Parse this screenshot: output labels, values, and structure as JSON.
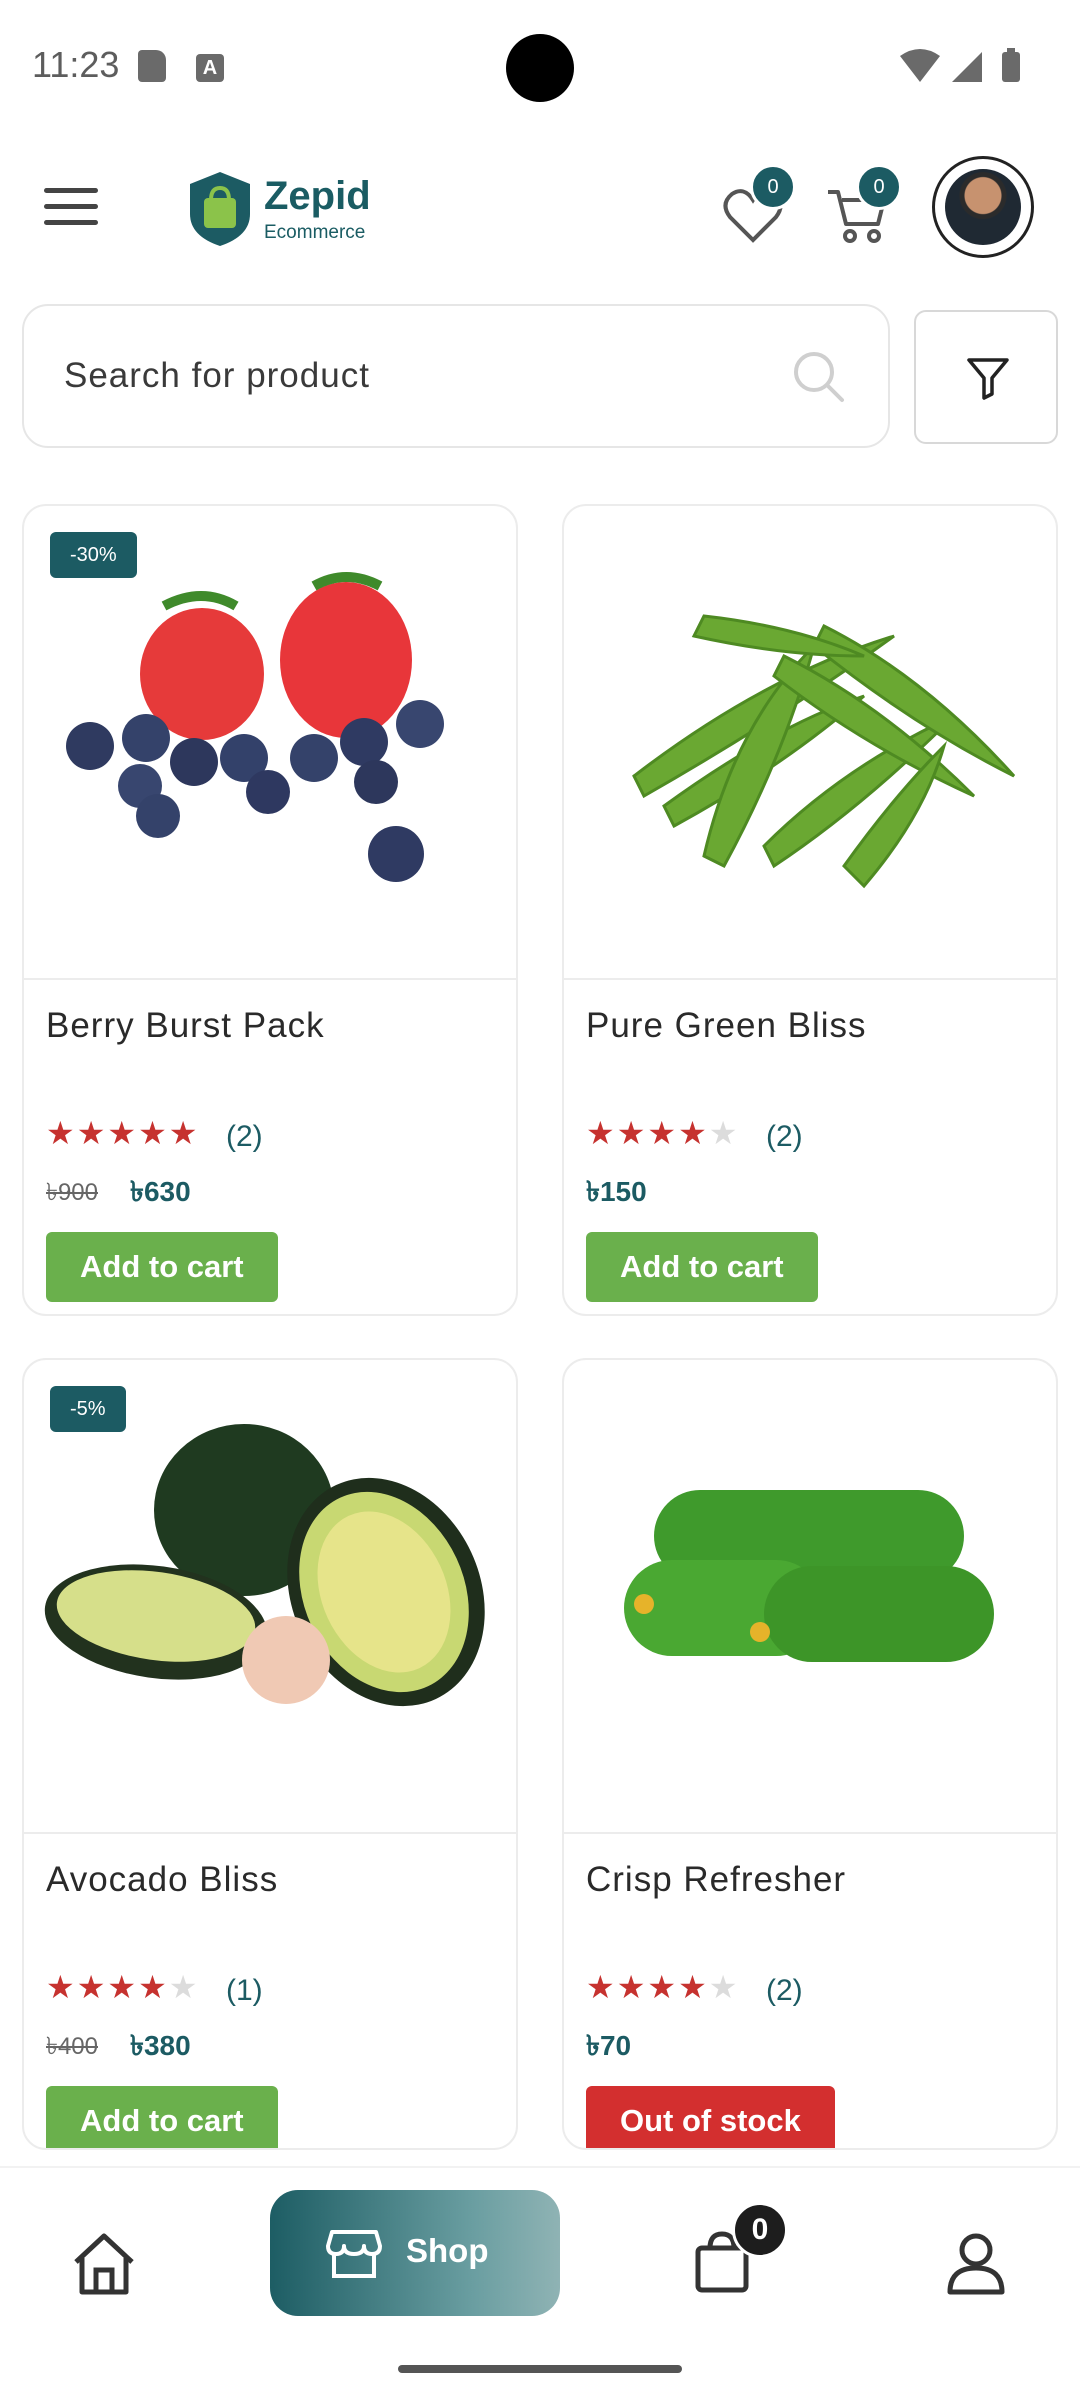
{
  "status": {
    "time": "11:23",
    "icons": [
      "sd-card-icon",
      "a-icon",
      "wifi-icon",
      "signal-icon",
      "battery-icon"
    ]
  },
  "header": {
    "logo_word": "Zepid",
    "logo_sub": "Ecommerce",
    "wishlist_count": "0",
    "cart_count": "0"
  },
  "search": {
    "placeholder": "Search for product"
  },
  "products": [
    {
      "name": "Berry Burst Pack",
      "discount": "-30%",
      "rating": 5,
      "reviews": "(2)",
      "old_price": "৳900",
      "price": "৳630",
      "action": "Add to cart"
    },
    {
      "name": "Pure Green Bliss",
      "discount": "",
      "rating": 4,
      "reviews": "(2)",
      "old_price": "",
      "price": "৳150",
      "action": "Add to cart"
    },
    {
      "name": "Avocado Bliss",
      "discount": "-5%",
      "rating": 4,
      "reviews": "(1)",
      "old_price": "৳400",
      "price": "৳380",
      "action": "Add to cart"
    },
    {
      "name": "Crisp Refresher",
      "discount": "",
      "rating": 4,
      "reviews": "(2)",
      "old_price": "",
      "price": "৳70",
      "action": "Out of stock"
    }
  ],
  "bottom_nav": {
    "shop_label": "Shop",
    "cart_count": "0",
    "items": [
      "home-icon",
      "shop-icon",
      "cart-icon",
      "profile-icon"
    ]
  },
  "colors": {
    "brand": "#1c5b63",
    "add_to_cart": "#6ab04c",
    "out_of_stock": "#d32f2f",
    "star": "#c6322f"
  }
}
